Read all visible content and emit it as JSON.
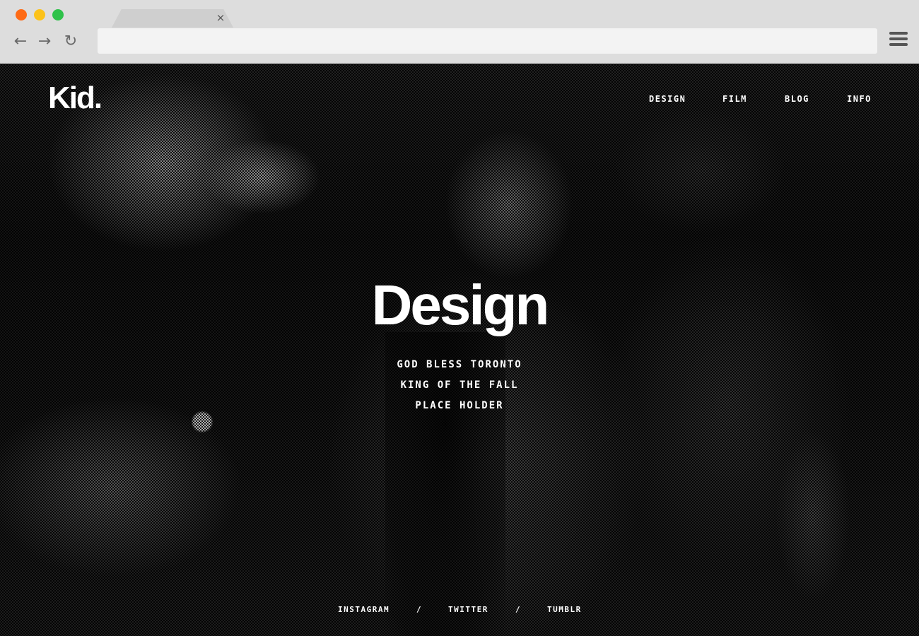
{
  "browser": {
    "tab_close": "×",
    "back": "←",
    "forward": "→",
    "reload": "↻",
    "colors": {
      "close": "#fe6a15",
      "minimize": "#fcc21a",
      "maximize": "#2fc24a"
    }
  },
  "site": {
    "logo": "Kid.",
    "nav": [
      "DESIGN",
      "FILM",
      "BLOG",
      "INFO"
    ]
  },
  "hero": {
    "title": "Design",
    "taglines": [
      "GOD BLESS TORONTO",
      "KING OF THE FALL",
      "PLACE HOLDER"
    ]
  },
  "footer": {
    "social": [
      "INSTAGRAM",
      "TWITTER",
      "TUMBLR"
    ],
    "separator": "/"
  }
}
